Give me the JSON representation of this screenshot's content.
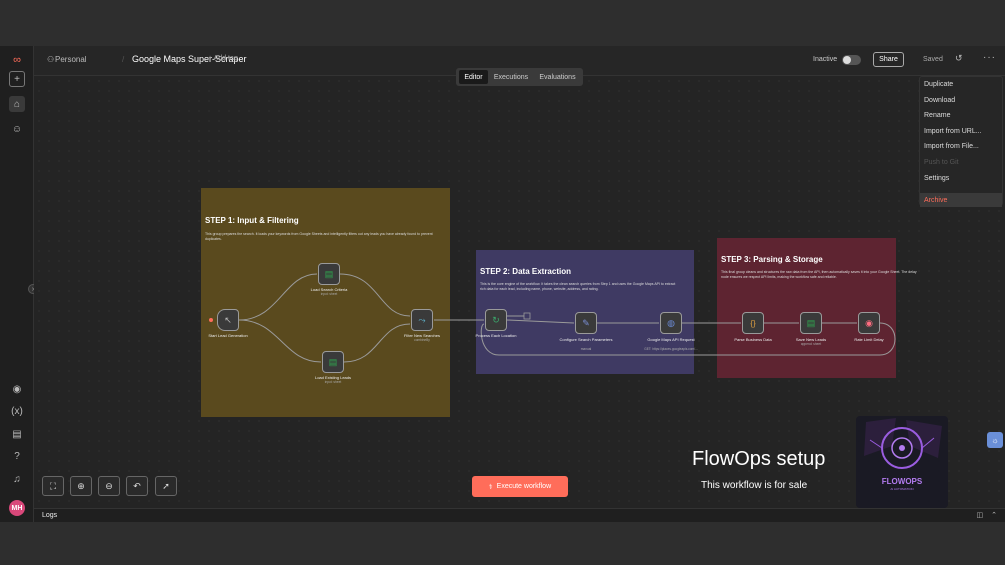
{
  "header": {
    "breadcrumb_project": "Personal",
    "title": "Google Maps Super-Scraper",
    "add_tag": "+ Add tag",
    "status_label": "Inactive",
    "share_label": "Share",
    "saved_label": "Saved",
    "more_label": "···"
  },
  "tabs": [
    {
      "label": "Editor",
      "active": true
    },
    {
      "label": "Executions",
      "active": false
    },
    {
      "label": "Evaluations",
      "active": false
    }
  ],
  "menu": {
    "items": [
      {
        "label": "Duplicate",
        "disabled": false
      },
      {
        "label": "Download",
        "disabled": false
      },
      {
        "label": "Rename",
        "disabled": false
      },
      {
        "label": "Import from URL...",
        "disabled": false
      },
      {
        "label": "Import from File...",
        "disabled": false
      },
      {
        "label": "Push to Git",
        "disabled": true
      },
      {
        "label": "Settings",
        "disabled": false
      },
      {
        "label": "Archive",
        "disabled": false,
        "danger": true
      }
    ]
  },
  "stickies": {
    "step1": {
      "title": "STEP 1: Input & Filtering",
      "body": "This group prepares the search. It loads your keywords from Google Sheets and intelligently filters out any leads you have already found to prevent duplicates."
    },
    "step2": {
      "title": "STEP 2: Data Extraction",
      "body": "This is the core engine of the workflow. It takes the clean search queries from Step 1 and uses the Google Maps API to extract rich data for each lead, including name, phone, website, address, and rating."
    },
    "step3": {
      "title": "STEP 3: Parsing & Storage",
      "body": "This final group cleans and structures the raw data from the API, then automatically saves it into your Google Sheet. The delay node ensures we respect API limits, making the workflow safe and reliable."
    }
  },
  "nodes": {
    "start": {
      "label": "Start Lead Generation",
      "sub": "",
      "icon": "↖",
      "color": "#bbbbbb"
    },
    "load_criteria": {
      "label": "Load Search Criteria",
      "sub": "input: sheet",
      "icon": "▤",
      "color": "#2fa84f"
    },
    "load_existing": {
      "label": "Load Existing Leads",
      "sub": "input: sheet",
      "icon": "▤",
      "color": "#2fa84f"
    },
    "filter": {
      "label": "Filter New Searches",
      "sub": "combineBy",
      "icon": "⤳",
      "color": "#5fb0c8"
    },
    "process": {
      "label": "Process Each Location",
      "sub": "",
      "icon": "↻",
      "color": "#3aa86b"
    },
    "configure": {
      "label": "Configure Search Parameters",
      "sub": "manual",
      "icon": "✎",
      "color": "#7b8fd6"
    },
    "google_api": {
      "label": "Google Maps API Request",
      "sub": "GET: https://places.googleapis.com/...",
      "icon": "◍",
      "color": "#6b8ad6"
    },
    "parse": {
      "label": "Parse Business Data",
      "sub": "",
      "icon": "{}",
      "color": "#e0a040"
    },
    "save": {
      "label": "Save New Leads",
      "sub": "append: sheet",
      "icon": "▤",
      "color": "#2fa84f"
    },
    "rate": {
      "label": "Rate Limit Delay",
      "sub": "",
      "icon": "◉",
      "color": "#ff6d80"
    }
  },
  "canvas": {
    "execute_label": "Execute workflow",
    "promo_title": "FlowOps setup",
    "promo_subtitle": "This workflow is for sale",
    "promo_logo_text": "FLOWOPS",
    "promo_logo_sub": "AI AUTOMATION"
  },
  "logs": {
    "label": "Logs"
  },
  "sidebar": {
    "avatar_initials": "MH"
  },
  "colors": {
    "accent": "#ff6d5a",
    "step1": "#5a4a1e",
    "step2": "#3f3a63",
    "step3": "#5e2431"
  }
}
